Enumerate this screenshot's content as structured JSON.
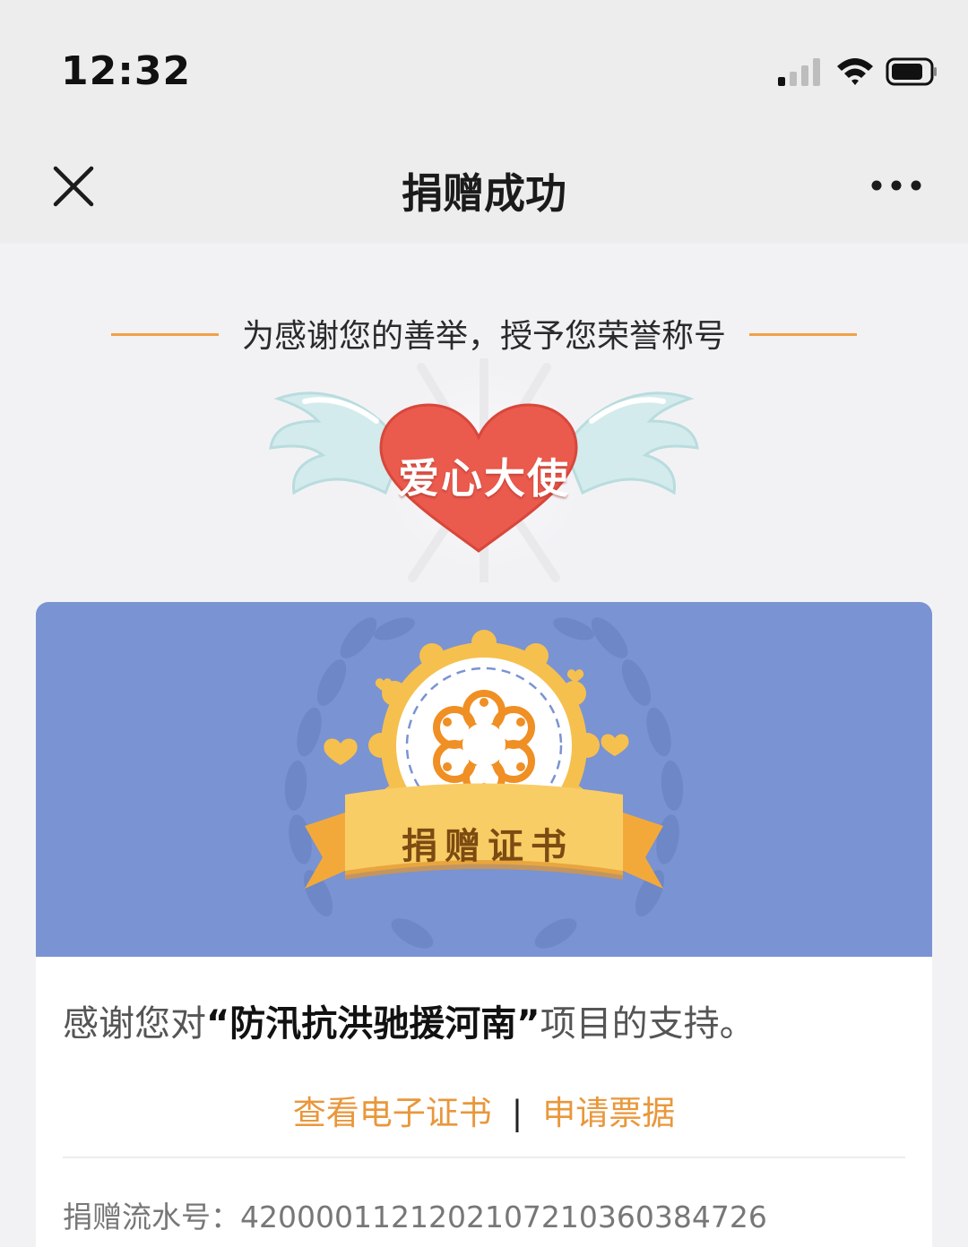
{
  "status_bar": {
    "time": "12:32"
  },
  "nav": {
    "title": "捐赠成功"
  },
  "honor": {
    "headline": "为感谢您的善举，授予您荣誉称号",
    "badge_title": "爱心大使"
  },
  "certificate": {
    "ribbon_label": "捐赠证书",
    "thanks_prefix": "感谢您对",
    "project_name": "“防汛抗洪驰援河南”",
    "thanks_suffix": "项目的支持。",
    "view_certificate_label": "查看电子证书",
    "separator": "|",
    "apply_invoice_label": "申请票据",
    "serial_label": "捐赠流水号：",
    "serial_number": "420000112120210721036038472‌6"
  },
  "colors": {
    "accent_orange": "#e9973b",
    "banner_blue": "#7a93d2",
    "heart_red": "#ea5a4d",
    "wing_teal": "#cfe9ea",
    "seal_gold": "#f6c04f"
  }
}
